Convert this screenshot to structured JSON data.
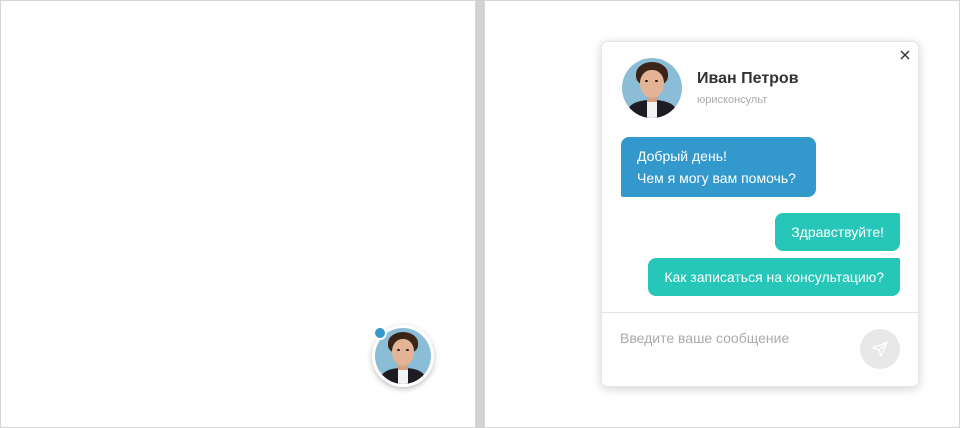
{
  "agent": {
    "name": "Иван Петров",
    "role": "юрисконсульт"
  },
  "messages": {
    "incoming": [
      "Добрый день!",
      "Чем я могу вам помочь?"
    ],
    "outgoing": [
      "Здравствуйте!",
      "Как записаться на консультацию?"
    ]
  },
  "input": {
    "placeholder": "Введите ваше сообщение"
  },
  "icons": {
    "close": "close-icon",
    "send": "send-icon",
    "status": "online-status-dot"
  },
  "colors": {
    "incoming_bubble": "#3399cc",
    "outgoing_bubble": "#26c6b9",
    "status_dot": "#3399cc",
    "send_button": "#e8e8e8"
  }
}
